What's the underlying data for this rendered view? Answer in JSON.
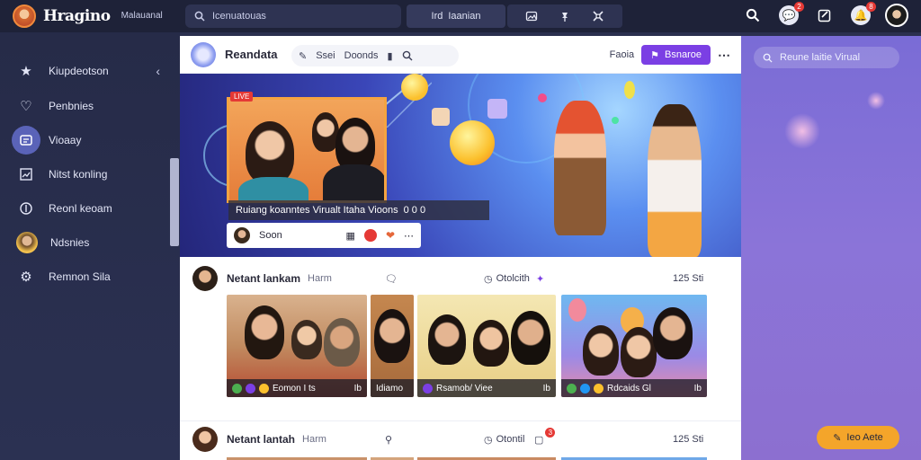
{
  "app": {
    "title": "Hragino",
    "subtitle": "Malauanal"
  },
  "topbar": {
    "search_placeholder": "Icenuatouas",
    "search_b_label": "Iaanian",
    "search_b_prefix": "Ird",
    "notif_badge": "2",
    "profile_badge": "8"
  },
  "sidebar": {
    "items": [
      {
        "label": "Kiupdeotson",
        "icon": "star-icon"
      },
      {
        "label": "Penbnies",
        "icon": "heart-icon"
      },
      {
        "label": "Vioaay",
        "icon": "tv-icon",
        "active": true
      },
      {
        "label": "Nitst konling",
        "icon": "chart-icon"
      },
      {
        "label": "Reonl keoam",
        "icon": "pin-icon"
      },
      {
        "label": "Ndsnies",
        "icon": "avatar-icon"
      },
      {
        "label": "Remnon Sila",
        "icon": "gear-icon"
      }
    ]
  },
  "channel": {
    "name": "Reandata",
    "tab_1": "Ssei",
    "tab_2": "Doonds",
    "secondary_label": "Faoia",
    "follow_label": "Bsnaroe"
  },
  "hero": {
    "live_tag": "LIVE",
    "caption": "Ruiang koanntes Virualt Itaha Vioons",
    "caption_suffix": "0 0 0",
    "reply_label": "Soon"
  },
  "posts": [
    {
      "name": "Netant lankam",
      "sub": "Harm",
      "meta_mid": "Otolcith",
      "meta_right": "125 Sti",
      "thumbs": [
        {
          "label": "Eomon I ts",
          "tail": "Ib"
        },
        {
          "label": "Idiamo"
        },
        {
          "label": "Rsamob/ Viee",
          "tail": "Ib"
        },
        {
          "label": "Rdcaids Gl",
          "tail": "Ib"
        }
      ]
    },
    {
      "name": "Netant lantah",
      "sub": "Harm",
      "meta_mid": "Otontil",
      "meta_right": "125 Sti",
      "badge": "3"
    }
  ],
  "right_panel": {
    "search_placeholder": "Reune laitie Virual"
  },
  "fab": {
    "label": "Ieo Aete"
  },
  "colors": {
    "accent": "#7b3fe4",
    "fab": "#f4a52a",
    "sidebar_active": "#5a63b8",
    "topbar": "#1e2238",
    "badge": "#e53935"
  }
}
